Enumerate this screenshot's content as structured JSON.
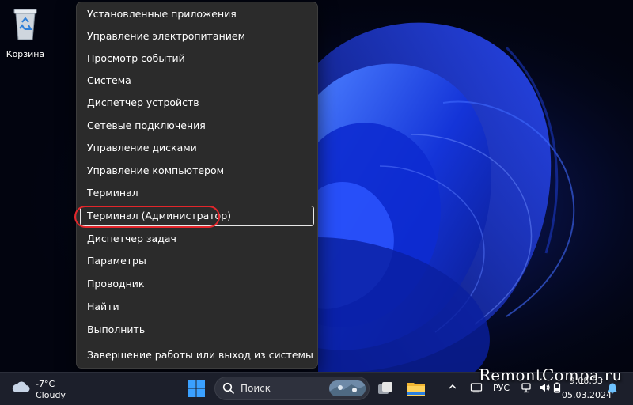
{
  "desktop": {
    "recycle_bin_label": "Корзина"
  },
  "context_menu": {
    "items": [
      {
        "label": "Установленные приложения"
      },
      {
        "label": "Управление электропитанием"
      },
      {
        "label": "Просмотр событий"
      },
      {
        "label": "Система"
      },
      {
        "label": "Диспетчер устройств"
      },
      {
        "label": "Сетевые подключения"
      },
      {
        "label": "Управление дисками"
      },
      {
        "label": "Управление компьютером"
      },
      {
        "label": "Терминал"
      },
      {
        "label": "Терминал (Администратор)",
        "focused": true,
        "highlighted": true
      },
      {
        "label": "Диспетчер задач"
      },
      {
        "label": "Параметры"
      },
      {
        "label": "Проводник"
      },
      {
        "label": "Найти"
      },
      {
        "label": "Выполнить"
      }
    ],
    "shutdown": {
      "label": "Завершение работы или выход из системы",
      "icon": "chevron-right-icon"
    },
    "highlight_color": "#e3262b"
  },
  "taskbar": {
    "weather": {
      "temperature": "-7°C",
      "condition": "Cloudy",
      "icon": "cloud-icon"
    },
    "start_icon": "windows-start-icon",
    "search": {
      "placeholder": "Поиск",
      "icon": "search-icon"
    },
    "apps": [
      "task-view-icon",
      "file-explorer-icon"
    ],
    "tray": {
      "icons": [
        "chevron-up-icon",
        "device-icon",
        "network-icon",
        "volume-icon",
        "battery-icon",
        "notification-bell-icon"
      ],
      "language": "РУС",
      "time": "9:08:53",
      "date": "05.03.2024"
    }
  },
  "watermark": "RemontCompa.ru",
  "colors": {
    "menu_bg": "#2b2b2b",
    "taskbar_bg": "#1c1f2b",
    "accent": "#1a6cff"
  }
}
